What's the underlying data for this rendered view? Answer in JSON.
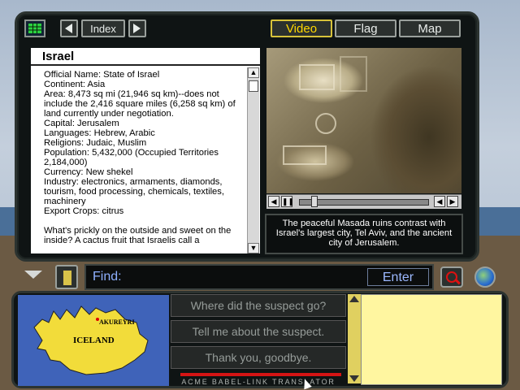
{
  "toolbar": {
    "index_label": "Index",
    "prev_icon": "left-arrow",
    "next_icon": "right-arrow",
    "tabs": [
      {
        "label": "Video",
        "active": true
      },
      {
        "label": "Flag",
        "active": false
      },
      {
        "label": "Map",
        "active": false
      }
    ]
  },
  "country": {
    "title": "Israel",
    "facts": [
      "Official Name: State of Israel",
      "Continent: Asia",
      "Area: 8,473 sq mi (21,946 sq km)--does not include the 2,416 square miles (6,258 sq km) of land currently under negotiation.",
      "Capital: Jerusalem",
      "Languages: Hebrew, Arabic",
      "Religions: Judaic, Muslim",
      "Population: 5,432,000 (Occupied Territories 2,184,000)",
      "Currency: New shekel",
      "Industry: electronics, armaments, diamonds, tourism, food processing, chemicals, textiles, machinery",
      "Export Crops: citrus"
    ],
    "trivia": "What's prickly on the outside and sweet on the inside? A cactus fruit that Israelis call a"
  },
  "video": {
    "caption": "The peaceful Masada ruins contrast with Israel's largest city, Tel Aviv, and the ancient city of Jerusalem.",
    "progress": 0.1
  },
  "find": {
    "label": "Find:",
    "value": "",
    "enter_label": "Enter"
  },
  "map": {
    "country_label": "ICELAND",
    "city_label": "AKUREYRI"
  },
  "questions": [
    "Where did the suspect go?",
    "Tell me about the suspect.",
    "Thank you, goodbye."
  ],
  "translator_label": "ACME BABEL-LINK TRANSLATOR",
  "colors": {
    "active_tab": "#ffd800",
    "find_text": "#8fb0ff",
    "notepad": "#fff6a0",
    "map_sea": "#3f63b9",
    "map_land": "#f2dc3a"
  }
}
